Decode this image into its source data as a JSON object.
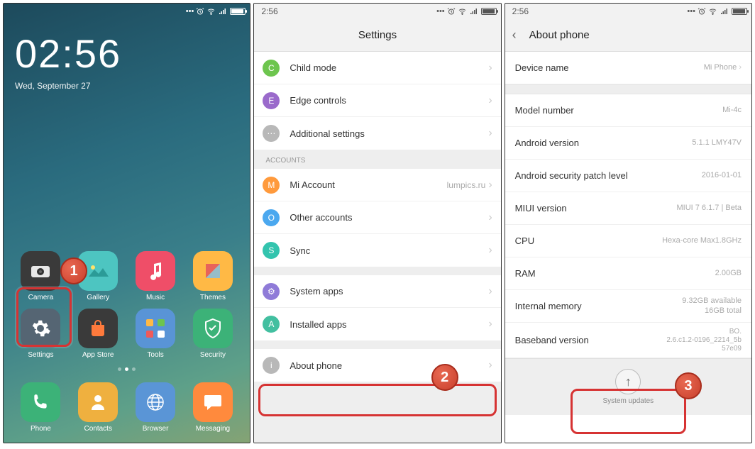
{
  "home": {
    "status": {
      "dots": "•••"
    },
    "clock_time": "02:56",
    "clock_date": "Wed, September 27",
    "apps_row1": [
      {
        "label": "Camera"
      },
      {
        "label": "Gallery"
      },
      {
        "label": "Music"
      },
      {
        "label": "Themes"
      }
    ],
    "apps_row2": [
      {
        "label": "Settings"
      },
      {
        "label": "App Store"
      },
      {
        "label": "Tools"
      },
      {
        "label": "Security"
      }
    ],
    "dock": [
      {
        "label": "Phone"
      },
      {
        "label": "Contacts"
      },
      {
        "label": "Browser"
      },
      {
        "label": "Messaging"
      }
    ],
    "step_badge": "1"
  },
  "settings": {
    "status_time": "2:56",
    "title": "Settings",
    "items1": [
      {
        "icon": "ic-green",
        "glyph": "C",
        "label": "Child mode"
      },
      {
        "icon": "ic-purple",
        "glyph": "E",
        "label": "Edge controls"
      },
      {
        "icon": "ic-grey",
        "glyph": "⋯",
        "label": "Additional settings"
      }
    ],
    "section_accounts": "ACCOUNTS",
    "items2": [
      {
        "icon": "ic-orange",
        "glyph": "M",
        "label": "Mi Account",
        "value": "lumpics.ru"
      },
      {
        "icon": "ic-blue",
        "glyph": "O",
        "label": "Other accounts"
      },
      {
        "icon": "ic-cyan",
        "glyph": "S",
        "label": "Sync"
      }
    ],
    "items3": [
      {
        "icon": "ic-violet",
        "glyph": "⚙",
        "label": "System apps"
      },
      {
        "icon": "ic-teal",
        "glyph": "A",
        "label": "Installed apps"
      }
    ],
    "about": {
      "icon": "ic-info",
      "glyph": "i",
      "label": "About phone"
    },
    "step_badge": "2"
  },
  "about": {
    "status_time": "2:56",
    "title": "About phone",
    "device_name": {
      "label": "Device name",
      "value": "Mi Phone"
    },
    "rows": [
      {
        "label": "Model number",
        "value": "Mi-4c"
      },
      {
        "label": "Android version",
        "value": "5.1.1 LMY47V"
      },
      {
        "label": "Android security patch level",
        "value": "2016-01-01"
      },
      {
        "label": "MIUI version",
        "value": "MIUI 7 6.1.7 | Beta"
      },
      {
        "label": "CPU",
        "value": "Hexa-core Max1.8GHz"
      },
      {
        "label": "RAM",
        "value": "2.00GB"
      }
    ],
    "memory": {
      "label": "Internal memory",
      "value1": "9.32GB available",
      "value2": "16GB total"
    },
    "baseband": {
      "label": "Baseband version",
      "value1": "BO.",
      "value2": "2.6.c1.2-0196_2214_5b",
      "value3": "57e09"
    },
    "updates_label": "System updates",
    "step_badge": "3"
  }
}
